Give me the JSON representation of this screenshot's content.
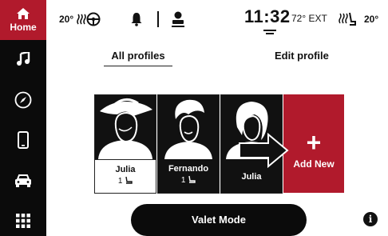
{
  "sidebar": {
    "home_label": "Home",
    "items": [
      {
        "icon": "music-note-icon"
      },
      {
        "icon": "compass-icon"
      },
      {
        "icon": "phone-icon"
      },
      {
        "icon": "car-icon"
      },
      {
        "icon": "apps-grid-icon"
      }
    ]
  },
  "status_bar": {
    "left_temp": "20°",
    "clock": "11:32",
    "outside_temp": "72° EXT",
    "right_temp": "20°"
  },
  "tabs": {
    "all_profiles": "All profiles",
    "edit_profile": "Edit profile"
  },
  "profiles": [
    {
      "name": "Julia",
      "seat": "1"
    },
    {
      "name": "Fernando",
      "seat": "1"
    },
    {
      "name": "Julia"
    }
  ],
  "add_new_label": "Add New",
  "valet_mode_label": "Valet Mode",
  "colors": {
    "accent": "#b11a2c",
    "dark": "#0b0b0b"
  }
}
